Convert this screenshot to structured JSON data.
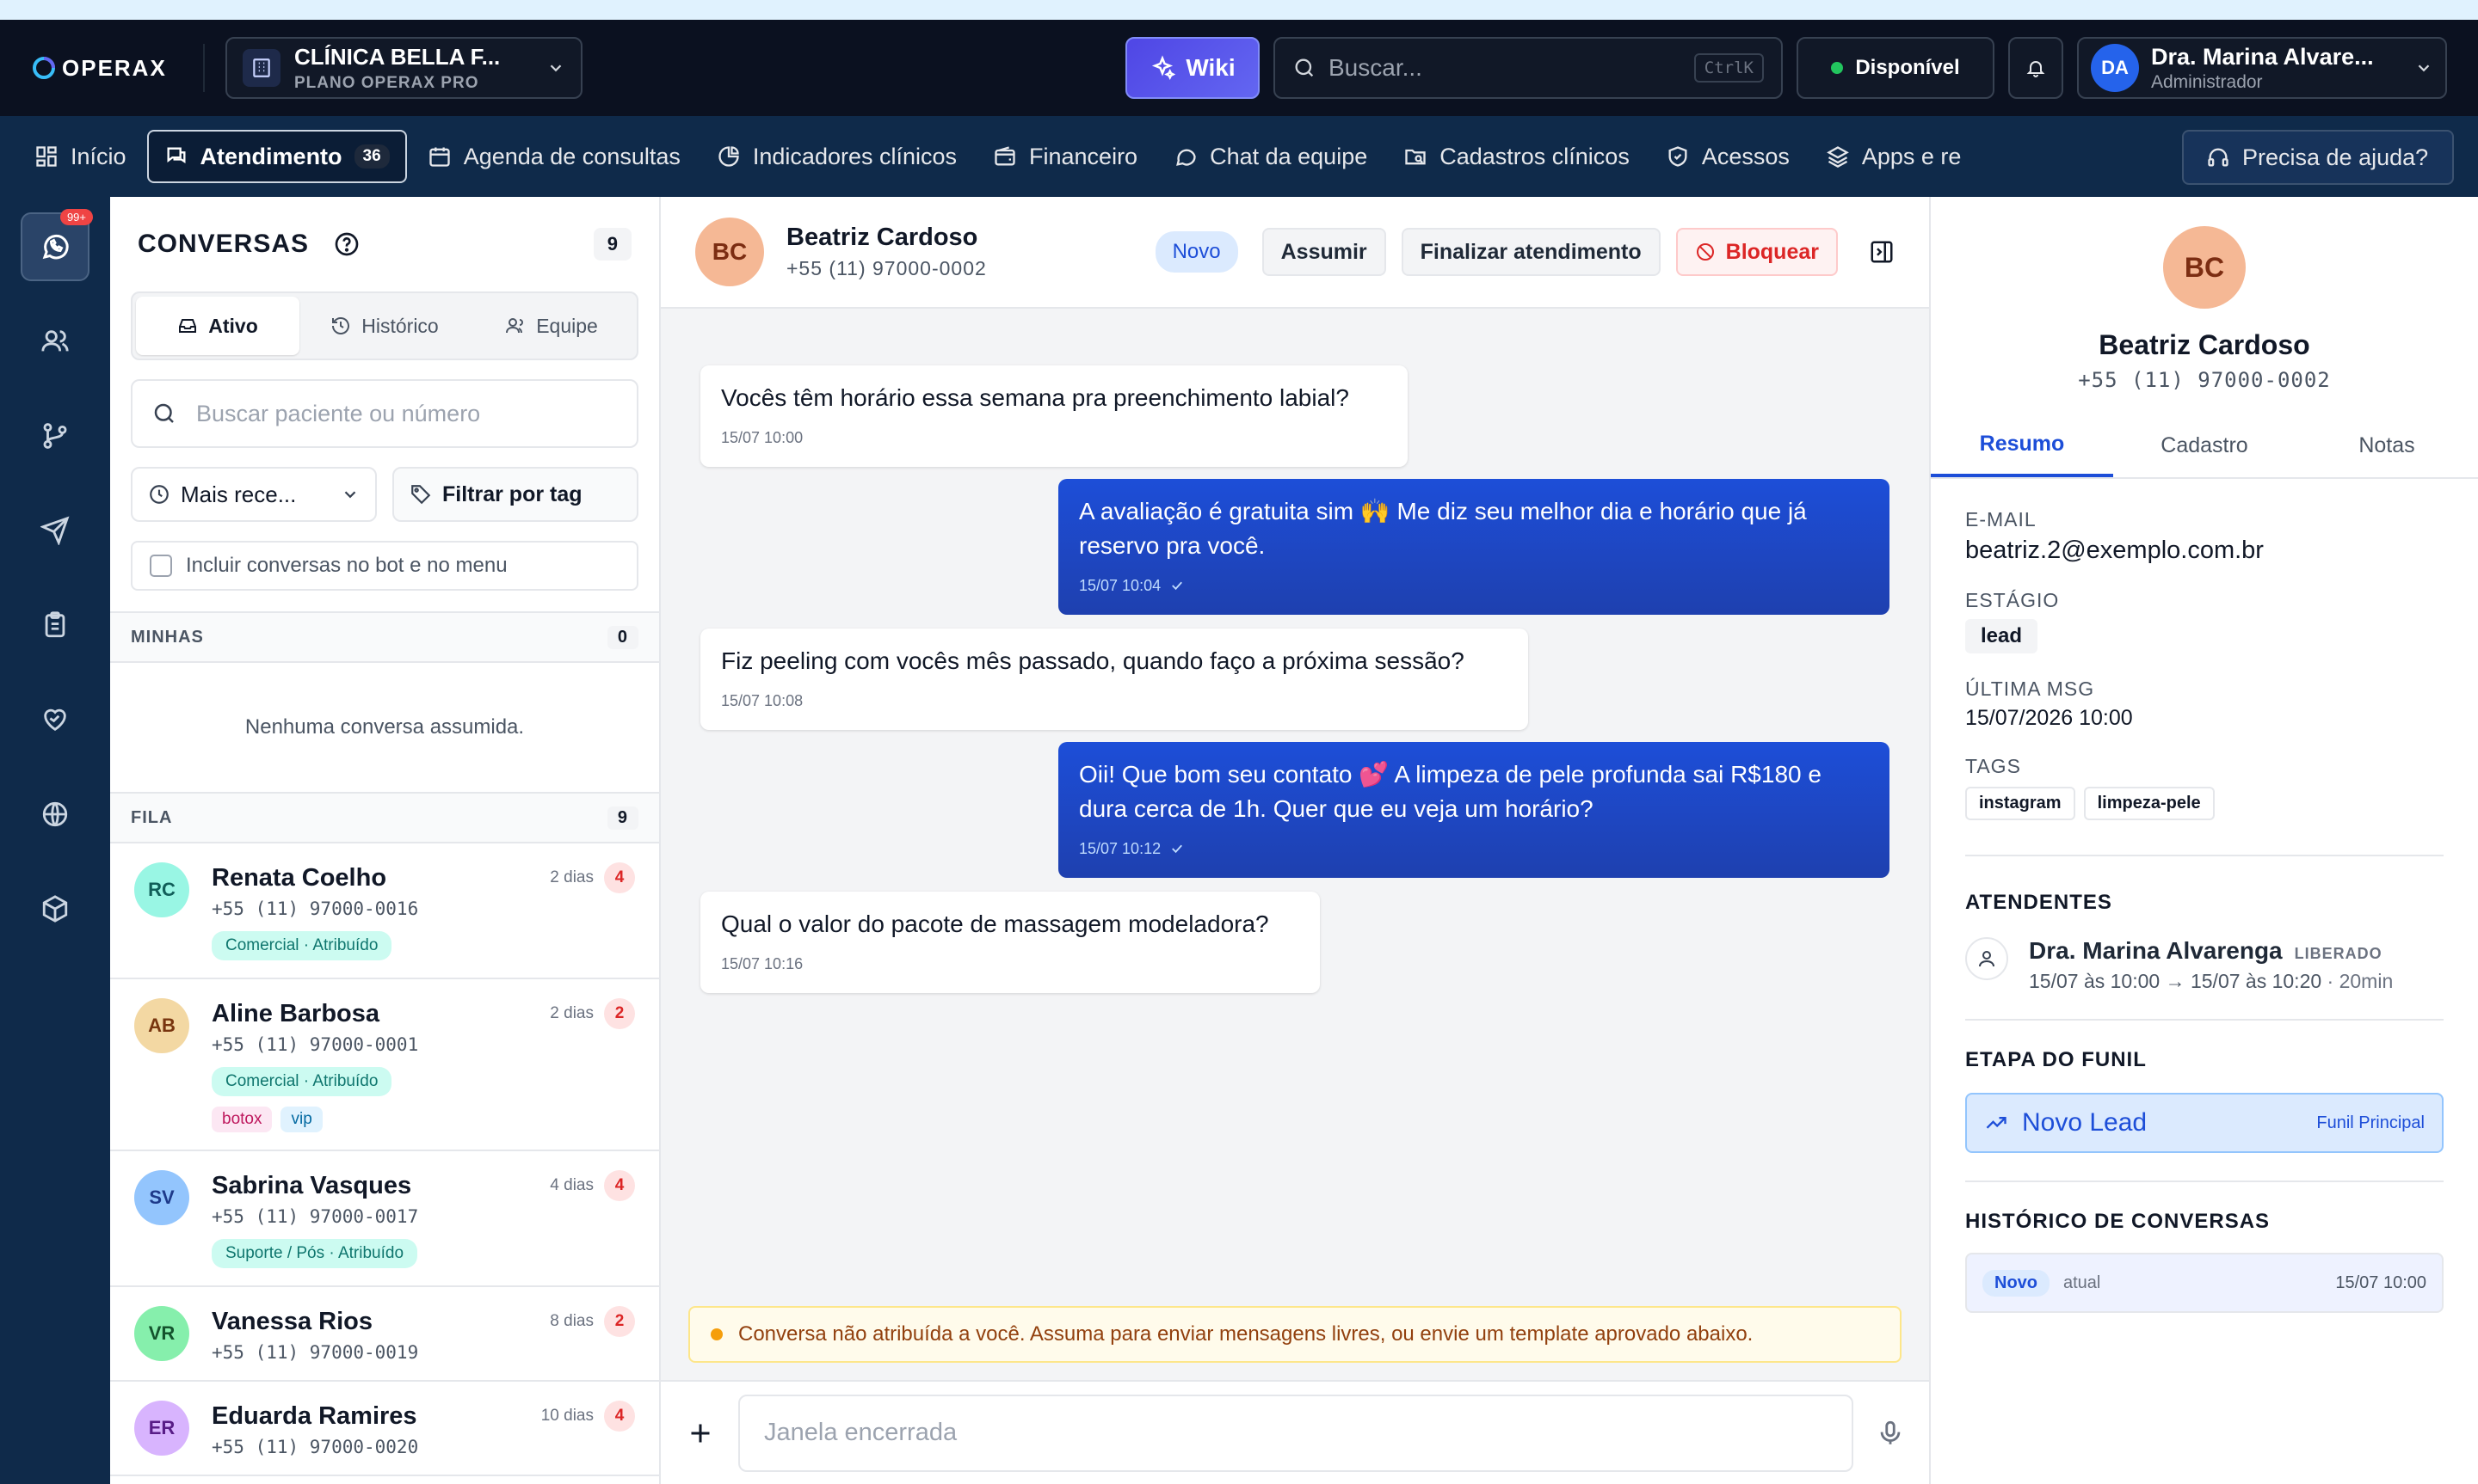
{
  "app": {
    "logo_text": "OPERAX"
  },
  "clinic": {
    "name": "CLÍNICA BELLA F...",
    "plan": "PLANO OPERAX PRO"
  },
  "topbar": {
    "wiki_label": "Wiki",
    "search_placeholder": "Buscar...",
    "search_shortcut": "CtrlK",
    "status_label": "Disponível"
  },
  "user": {
    "initials": "DA",
    "name": "Dra. Marina Alvare...",
    "role": "Administrador"
  },
  "nav": {
    "items": [
      {
        "label": "Início",
        "icon": "grid-icon"
      },
      {
        "label": "Atendimento",
        "icon": "chat-icon",
        "count": "36",
        "active": true
      },
      {
        "label": "Agenda de consultas",
        "icon": "calendar-icon"
      },
      {
        "label": "Indicadores clínicos",
        "icon": "pie-chart-icon"
      },
      {
        "label": "Financeiro",
        "icon": "wallet-icon"
      },
      {
        "label": "Chat da equipe",
        "icon": "message-circle-icon"
      },
      {
        "label": "Cadastros clínicos",
        "icon": "folder-search-icon"
      },
      {
        "label": "Acessos",
        "icon": "shield-icon"
      },
      {
        "label": "Apps e re",
        "icon": "layers-icon"
      }
    ],
    "help_label": "Precisa de ajuda?"
  },
  "rail": {
    "badge": "99+"
  },
  "conversations": {
    "title": "CONVERSAS",
    "total": "9",
    "tabs": [
      {
        "label": "Ativo",
        "icon": "inbox-icon"
      },
      {
        "label": "Histórico",
        "icon": "history-icon"
      },
      {
        "label": "Equipe",
        "icon": "users-icon"
      }
    ],
    "search_placeholder": "Buscar paciente ou número",
    "sort_label": "Mais rece...",
    "tag_filter_label": "Filtrar por tag",
    "include_bot_label": "Incluir conversas no bot e no menu",
    "mine": {
      "label": "MINHAS",
      "count": "0",
      "empty": "Nenhuma conversa assumida."
    },
    "queue": {
      "label": "FILA",
      "count": "9"
    },
    "items": [
      {
        "initials": "RC",
        "name": "Renata Coelho",
        "time": "2 dias",
        "unread": "4",
        "phone": "+55 (11) 97000-0016",
        "queue_tag": "Comercial · Atribuído",
        "color": "#99f6e4",
        "text_color": "#115e59",
        "tags": []
      },
      {
        "initials": "AB",
        "name": "Aline Barbosa",
        "time": "2 dias",
        "unread": "2",
        "phone": "+55 (11) 97000-0001",
        "queue_tag": "Comercial · Atribuído",
        "color": "#f3d8a3",
        "text_color": "#78350f",
        "tags": [
          {
            "label": "botox",
            "style": "pink"
          },
          {
            "label": "vip",
            "style": "blue"
          }
        ]
      },
      {
        "initials": "SV",
        "name": "Sabrina Vasques",
        "time": "4 dias",
        "unread": "4",
        "phone": "+55 (11) 97000-0017",
        "queue_tag": "Suporte / Pós · Atribuído",
        "color": "#93c5fd",
        "text_color": "#1e3a8a",
        "tags": []
      },
      {
        "initials": "VR",
        "name": "Vanessa Rios",
        "time": "8 dias",
        "unread": "2",
        "phone": "+55 (11) 97000-0019",
        "queue_tag": "",
        "color": "#86efac",
        "text_color": "#14532d",
        "tags": []
      },
      {
        "initials": "ER",
        "name": "Eduarda Ramires",
        "time": "10 dias",
        "unread": "4",
        "phone": "+55 (11) 97000-0020",
        "queue_tag": "",
        "color": "#d8b4fe",
        "text_color": "#581c87",
        "tags": []
      }
    ]
  },
  "chat": {
    "contact": {
      "initials": "BC",
      "name": "Beatriz Cardoso",
      "phone": "+55 (11) 97000-0002"
    },
    "status_pill": "Novo",
    "assume_label": "Assumir",
    "finish_label": "Finalizar atendimento",
    "block_label": "Bloquear",
    "messages": [
      {
        "dir": "in",
        "lines": [
          "Vocês têm horário essa semana pra preenchimento labial?"
        ],
        "time": "15/07 10:00"
      },
      {
        "dir": "out",
        "lines": [
          "A avaliação é gratuita sim 🙌 Me diz seu melhor dia e horário que já",
          "reservo pra você."
        ],
        "time": "15/07 10:04"
      },
      {
        "dir": "in",
        "lines": [
          "Fiz peeling com vocês mês passado, quando faço a próxima sessão?"
        ],
        "time": "15/07 10:08"
      },
      {
        "dir": "out",
        "lines": [
          "Oii! Que bom seu contato 💕 A limpeza de pele profunda sai R$180 e",
          "dura cerca de 1h. Quer que eu veja um horário?"
        ],
        "time": "15/07 10:12"
      },
      {
        "dir": "in",
        "lines": [
          "Qual o valor do pacote de massagem modeladora?"
        ],
        "time": "15/07 10:16"
      }
    ],
    "warning": "Conversa não atribuída a você. Assuma para enviar mensagens livres, ou envie um template aprovado abaixo.",
    "composer_placeholder": "Janela encerrada"
  },
  "details": {
    "initials": "BC",
    "name": "Beatriz Cardoso",
    "phone": "+55 (11) 97000-0002",
    "tabs": [
      "Resumo",
      "Cadastro",
      "Notas"
    ],
    "email_label": "E-MAIL",
    "email": "beatriz.2@exemplo.com.br",
    "stage_label": "ESTÁGIO",
    "stage": "lead",
    "last_msg_label": "ÚLTIMA MSG",
    "last_msg": "15/07/2026 10:00",
    "tags_label": "TAGS",
    "tags": [
      "instagram",
      "limpeza-pele"
    ],
    "attendants_label": "ATENDENTES",
    "attendant": {
      "name": "Dra. Marina Alvarenga",
      "status": "LIBERADO",
      "period": "15/07 às 10:00 → 15/07 às 10:20",
      "duration": "· 20min"
    },
    "funnel_label": "ETAPA DO FUNIL",
    "funnel_stage": "Novo Lead",
    "funnel_name": "Funil Principal",
    "history_label": "HISTÓRICO DE CONVERSAS",
    "history": {
      "status": "Novo",
      "current": "atual",
      "time": "15/07 10:00"
    }
  },
  "colors": {
    "accent": "#1d4ed8",
    "topbar": "#0b1120",
    "nav": "#0f2a4a",
    "bubble_out": "#1e40af"
  }
}
